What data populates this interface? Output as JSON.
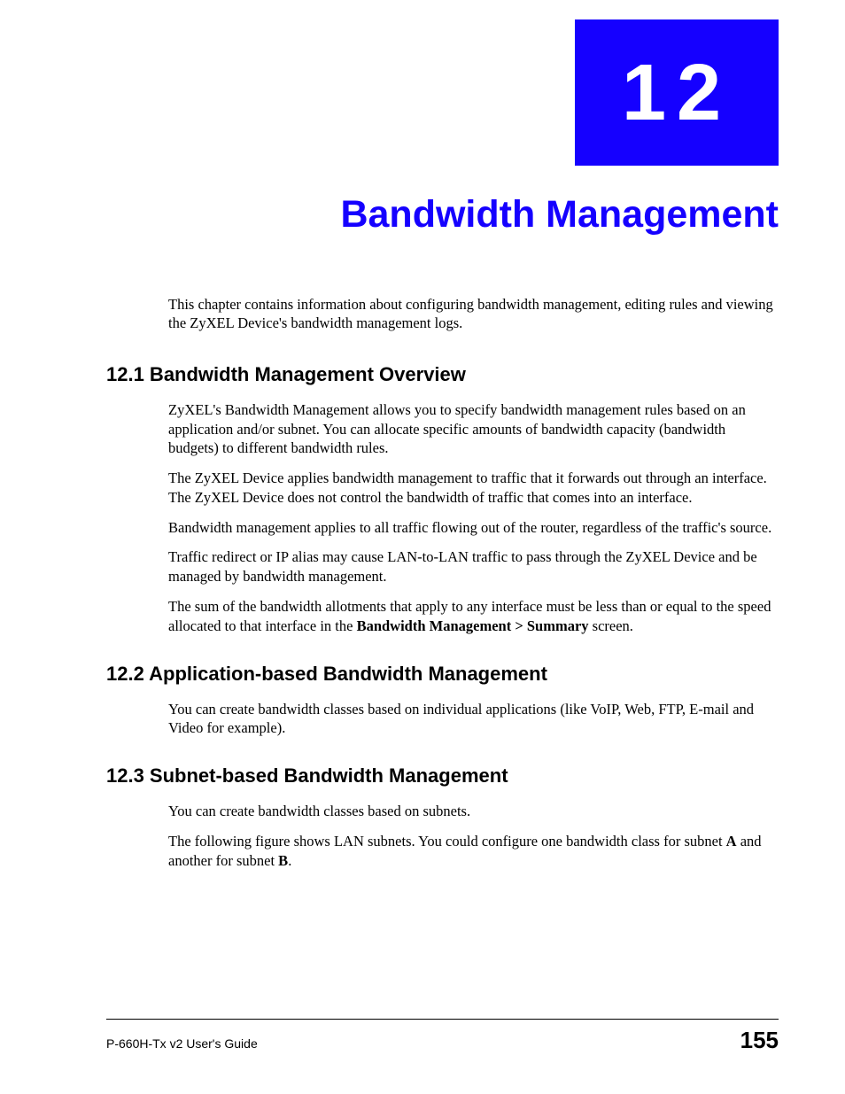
{
  "chapter": {
    "number": "12",
    "title": "Bandwidth Management"
  },
  "intro": "This chapter contains information about configuring bandwidth management, editing rules and viewing the ZyXEL Device's bandwidth management logs.",
  "sections": {
    "s1": {
      "heading": "12.1  Bandwidth Management Overview",
      "p1": "ZyXEL's Bandwidth Management allows you to specify bandwidth management rules based on an application and/or subnet. You can allocate specific amounts of bandwidth capacity (bandwidth budgets) to different bandwidth rules.",
      "p2": "The ZyXEL Device applies bandwidth management to traffic that it forwards out through an interface. The ZyXEL Device does not control the bandwidth of traffic that comes into an interface.",
      "p3": "Bandwidth management applies to all traffic flowing out of the router, regardless of the traffic's source.",
      "p4": "Traffic redirect or IP alias may cause LAN-to-LAN traffic to pass through the ZyXEL Device and be managed by bandwidth management.",
      "p5_pre": "The sum of the bandwidth allotments that apply to any interface must be less than or equal to the speed allocated to that interface in the ",
      "p5_bold": "Bandwidth Management > Summary",
      "p5_post": " screen."
    },
    "s2": {
      "heading": "12.2  Application-based Bandwidth Management",
      "p1": "You can create bandwidth classes based on individual applications (like VoIP, Web, FTP, E-mail and Video for example)."
    },
    "s3": {
      "heading": "12.3  Subnet-based Bandwidth Management",
      "p1": "You can create bandwidth classes based on subnets.",
      "p2_pre": "The following figure shows LAN subnets. You could configure one bandwidth class for subnet ",
      "p2_boldA": "A",
      "p2_mid": " and another for subnet ",
      "p2_boldB": "B",
      "p2_post": "."
    }
  },
  "footer": {
    "guide": "P-660H-Tx v2 User's Guide",
    "page": "155"
  }
}
